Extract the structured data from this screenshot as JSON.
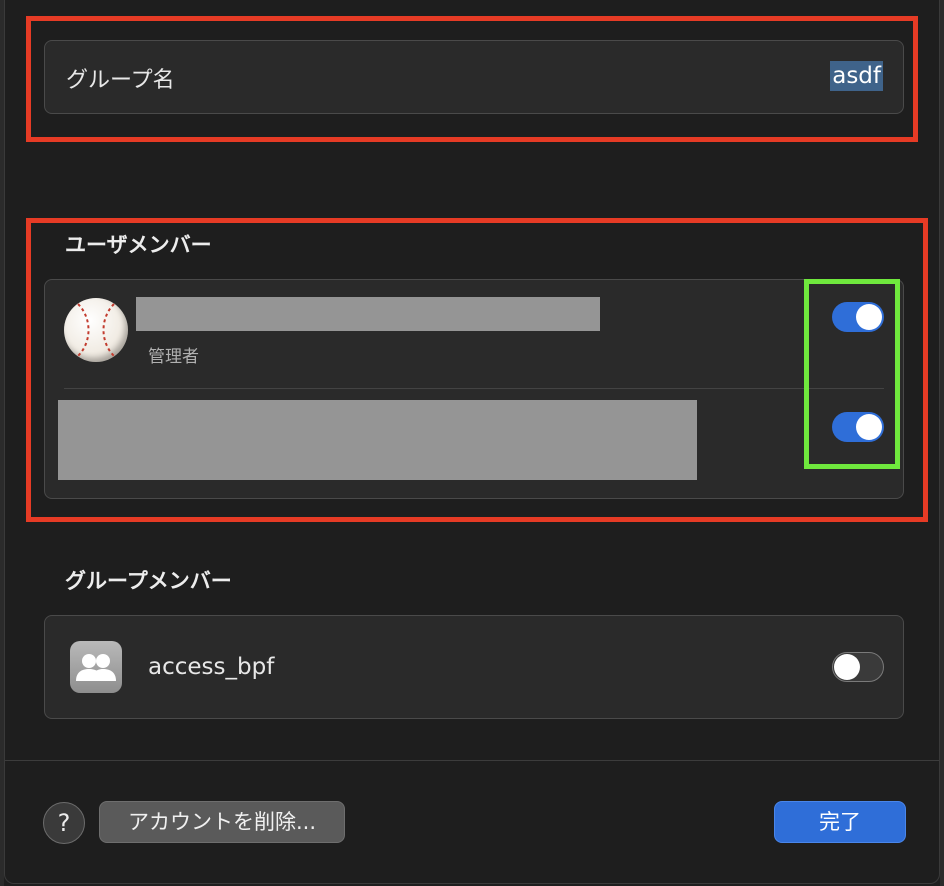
{
  "group_name": {
    "label": "グループ名",
    "value": "asdf"
  },
  "user_members": {
    "title": "ユーザメンバー",
    "items": [
      {
        "role": "管理者",
        "enabled": true,
        "avatar_icon": "baseball-icon"
      },
      {
        "role": "",
        "enabled": true
      }
    ]
  },
  "group_members": {
    "title": "グループメンバー",
    "items": [
      {
        "name": "access_bpf",
        "enabled": false,
        "icon": "group-icon"
      }
    ]
  },
  "footer": {
    "help_label": "?",
    "delete_label": "アカウントを削除...",
    "done_label": "完了"
  },
  "colors": {
    "accent": "#2f6ed8",
    "annotation_red": "#e63b25",
    "annotation_green": "#6fe83d"
  }
}
